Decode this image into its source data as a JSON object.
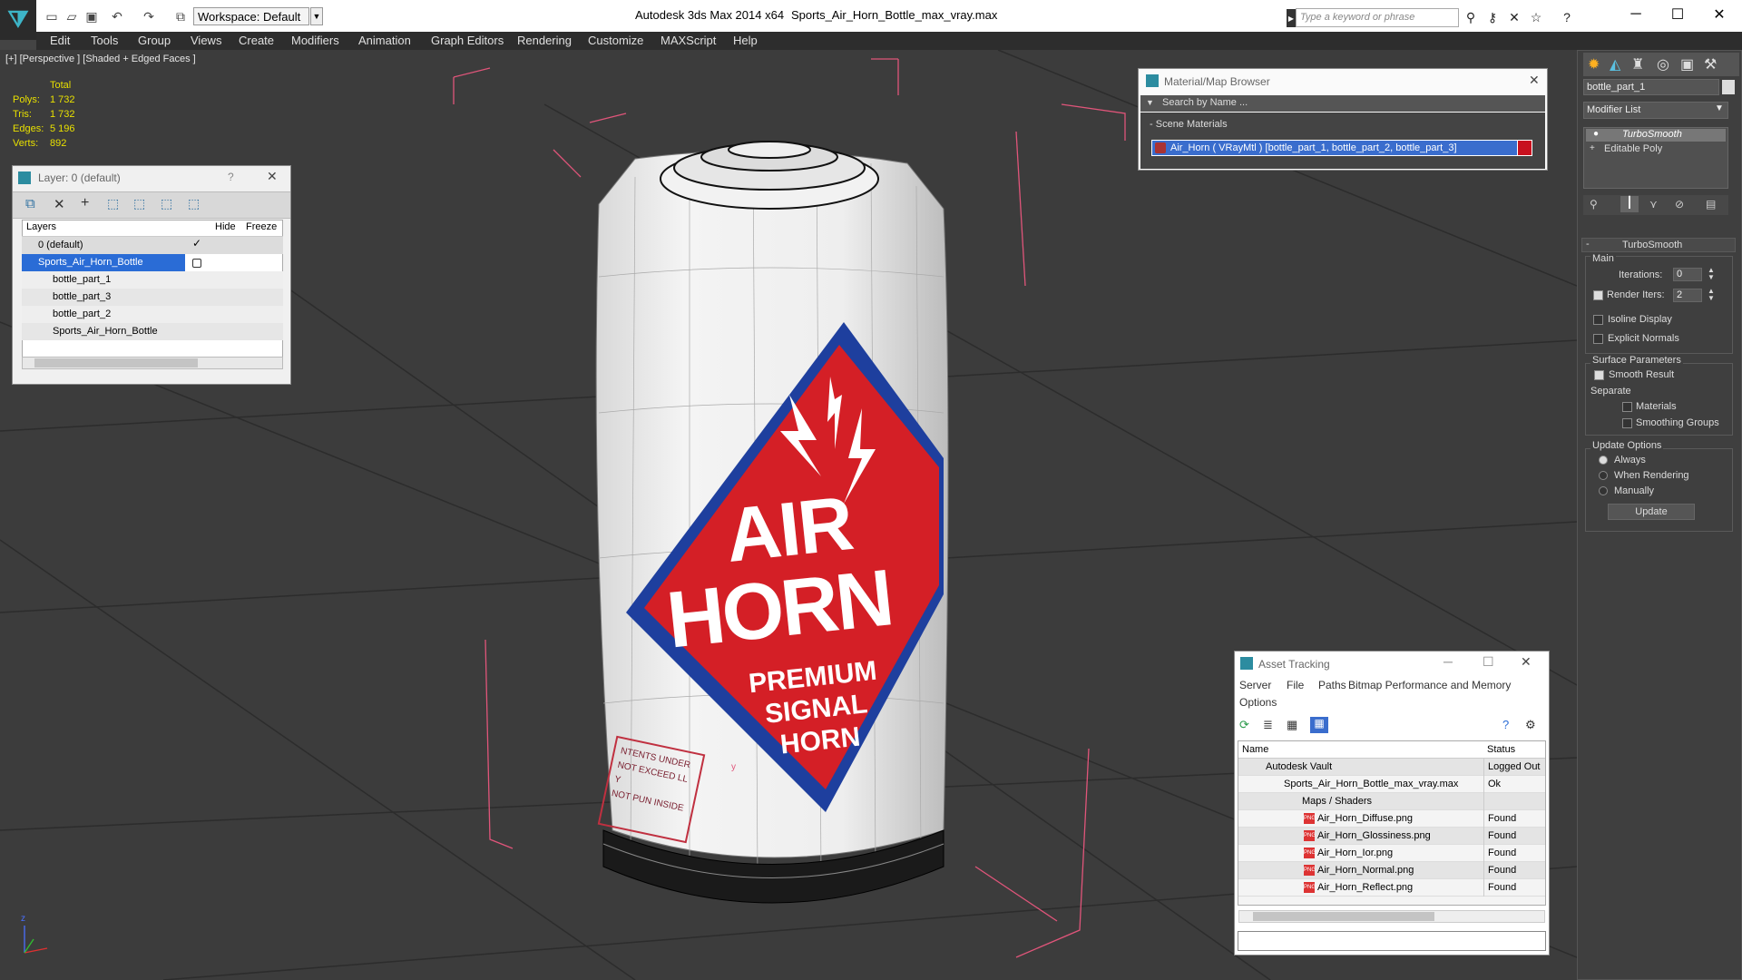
{
  "app": {
    "title": "Autodesk 3ds Max  2014 x64",
    "document": "Sports_Air_Horn_Bottle_max_vray.max",
    "workspace": "Workspace: Default",
    "search_placeholder": "Type a keyword or phrase"
  },
  "menu": [
    "Edit",
    "Tools",
    "Group",
    "Views",
    "Create",
    "Modifiers",
    "Animation",
    "Graph Editors",
    "Rendering",
    "Customize",
    "MAXScript",
    "Help"
  ],
  "viewport": {
    "label": "[+] [Perspective ] [Shaded + Edged Faces ]",
    "stats": {
      "header": "Total",
      "rows": [
        {
          "label": "Polys:",
          "value": "1 732"
        },
        {
          "label": "Tris:",
          "value": "1 732"
        },
        {
          "label": "Edges:",
          "value": "5 196"
        },
        {
          "label": "Verts:",
          "value": "892"
        }
      ]
    },
    "axis": {
      "z": "z",
      "x": "x",
      "y": "y"
    }
  },
  "label_art": {
    "line1": "AIR",
    "line2": "HORN",
    "line3": "PREMIUM",
    "line4": "SIGNAL",
    "line5": "HORN",
    "side1": "NTENTS UNDER",
    "side2": "NOT EXCEED LL Y",
    "side3": "NOT PUN INSIDE"
  },
  "layer_panel": {
    "title": "Layer: 0 (default)",
    "help": "?",
    "columns": {
      "layers": "Layers",
      "hide": "Hide",
      "freeze": "Freeze"
    },
    "rows": [
      {
        "name": "0 (default)",
        "indent": 0
      },
      {
        "name": "Sports_Air_Horn_Bottle",
        "indent": 0
      },
      {
        "name": "bottle_part_1",
        "indent": 1
      },
      {
        "name": "bottle_part_3",
        "indent": 1
      },
      {
        "name": "bottle_part_2",
        "indent": 1
      },
      {
        "name": "Sports_Air_Horn_Bottle",
        "indent": 1
      }
    ]
  },
  "material_browser": {
    "title": "Material/Map Browser",
    "search_placeholder": "Search by Name ...",
    "group": "Scene Materials",
    "material": "Air_Horn  ( VRayMtl ) [bottle_part_1, bottle_part_2, bottle_part_3]",
    "swatch_color": "#c8101e"
  },
  "command_panel": {
    "object_name": "bottle_part_1",
    "modifier_list": "Modifier List",
    "stack": [
      "TurboSmooth",
      "Editable Poly"
    ],
    "rollout": "TurboSmooth",
    "main": "Main",
    "iterations_label": "Iterations:",
    "iterations": "0",
    "render_iters_label": "Render Iters:",
    "render_iters": "2",
    "isoline": "Isoline Display",
    "explicit_normals": "Explicit Normals",
    "surface": "Surface Parameters",
    "smooth_result": "Smooth Result",
    "separate": "Separate",
    "materials": "Materials",
    "smoothing_groups": "Smoothing Groups",
    "update_options": "Update Options",
    "always": "Always",
    "when_rendering": "When Rendering",
    "manually": "Manually",
    "update": "Update"
  },
  "asset_tracking": {
    "title": "Asset Tracking",
    "menu": [
      "Server",
      "File",
      "Paths",
      "Bitmap Performance and Memory"
    ],
    "options": "Options",
    "columns": {
      "name": "Name",
      "status": "Status"
    },
    "rows": [
      {
        "name": "Autodesk Vault",
        "status": "Logged Out",
        "indent": 1
      },
      {
        "name": "Sports_Air_Horn_Bottle_max_vray.max",
        "status": "Ok",
        "indent": 2
      },
      {
        "name": "Maps / Shaders",
        "status": "",
        "indent": 3
      },
      {
        "name": "Air_Horn_Diffuse.png",
        "status": "Found",
        "indent": 4
      },
      {
        "name": "Air_Horn_Glossiness.png",
        "status": "Found",
        "indent": 4
      },
      {
        "name": "Air_Horn_Ior.png",
        "status": "Found",
        "indent": 4
      },
      {
        "name": "Air_Horn_Normal.png",
        "status": "Found",
        "indent": 4
      },
      {
        "name": "Air_Horn_Reflect.png",
        "status": "Found",
        "indent": 4
      }
    ]
  },
  "colors": {
    "accent": "#3399ff",
    "label_red": "#d41f26",
    "label_blue": "#1e3f9e",
    "selection": "#2a6cd6"
  }
}
